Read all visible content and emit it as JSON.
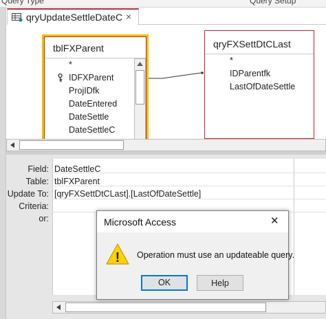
{
  "ribbon": {
    "left_label": "Query Type",
    "right_label": "Query Setup"
  },
  "tab": {
    "title": "qryUpdateSettleDateC",
    "close": "×"
  },
  "tables": {
    "parent": {
      "title": "tblFXParent",
      "fields": [
        "*",
        "IDFXParent",
        "ProjIDfk",
        "DateEntered",
        "DateSettle",
        "DateSettleC"
      ]
    },
    "last": {
      "title": "qryFXSettDtCLast",
      "fields": [
        "*",
        "IDParentfk",
        "LastOfDateSettle"
      ]
    }
  },
  "grid": {
    "labels": {
      "field": "Field:",
      "table": "Table:",
      "update_to": "Update To:",
      "criteria": "Criteria:",
      "or": "or:"
    },
    "column1": {
      "field": "DateSettleC",
      "table": "tblFXParent",
      "update_to": "[qryFXSettDtCLast].[LastOfDateSettle]"
    }
  },
  "dialog": {
    "title": "Microsoft Access",
    "close": "✕",
    "message": "Operation must use an updateable query.",
    "ok": "OK",
    "help": "Help",
    "warning_glyph": "!"
  },
  "colors": {
    "accent_tab": "#a4373a",
    "parent_border_outer": "#f0c000",
    "parent_border_inner": "#c0262c",
    "last_border": "#c0262c",
    "warning_fill": "#ffd200",
    "default_button": "#0078d7"
  }
}
